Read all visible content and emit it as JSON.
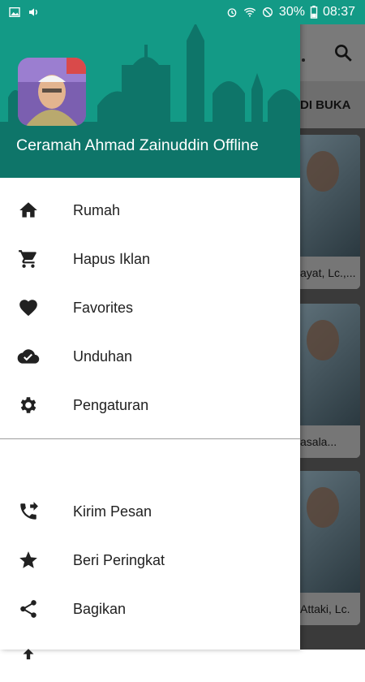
{
  "status_bar": {
    "battery": "30%",
    "time": "08:37"
  },
  "background": {
    "tab_label": "DI BUKA",
    "cards": [
      {
        "caption": "ayat, Lc.,..."
      },
      {
        "caption": "asala..."
      },
      {
        "caption": "Attaki, Lc."
      }
    ]
  },
  "drawer": {
    "header_title": "Ceramah Ahmad Zainuddin Offline",
    "primary_items": [
      {
        "label": "Rumah",
        "icon": "home-icon"
      },
      {
        "label": "Hapus Iklan",
        "icon": "cart-icon"
      },
      {
        "label": "Favorites",
        "icon": "heart-icon"
      },
      {
        "label": "Unduhan",
        "icon": "cloud-done-icon"
      },
      {
        "label": "Pengaturan",
        "icon": "gear-icon"
      }
    ],
    "secondary_items": [
      {
        "label": "Kirim Pesan",
        "icon": "phone-forward-icon"
      },
      {
        "label": "Beri Peringkat",
        "icon": "star-icon"
      },
      {
        "label": "Bagikan",
        "icon": "share-icon"
      }
    ]
  },
  "colors": {
    "primary": "#139a86",
    "scrim": "#3a3a3a"
  }
}
